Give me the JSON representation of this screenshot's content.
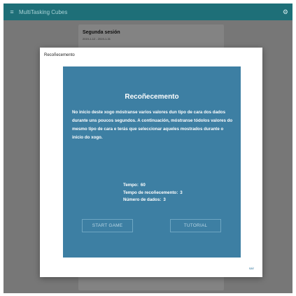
{
  "header": {
    "app_title": "MultiTasking Cubes",
    "menu_icon": "menu-icon",
    "settings_icon": "gear-icon",
    "color": "#1e6f78"
  },
  "background_card": {
    "title": "Segunda sesión",
    "dates": "2019-1-12 - 2019-1-31"
  },
  "dialog": {
    "title": "Recoñecemento",
    "panel": {
      "heading": "Recoñecemento",
      "description": "No inicio deste xogo móstranse varios valores dun tipo de cara dos dados durante uns poucos segundos. A continuación, móstranse tódolos valores do mesmo tipo de cara e terás que seleccionar aqueles mostrados durante o inicio do xogo.",
      "stats": [
        {
          "label": "Tempo:",
          "value": "60"
        },
        {
          "label": "Tempo de recoñecemento:",
          "value": "3"
        },
        {
          "label": "Número de dados:",
          "value": "3"
        }
      ],
      "color": "#3d7fa3"
    },
    "buttons": {
      "start": "START GAME",
      "tutorial": "TUTORIAL"
    },
    "exit": "sair"
  }
}
